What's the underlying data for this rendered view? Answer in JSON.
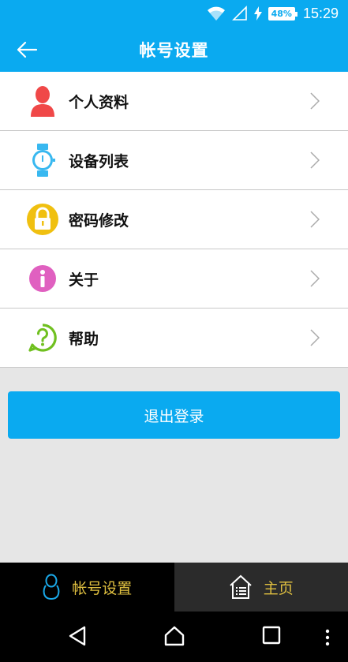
{
  "status_bar": {
    "battery": "48%",
    "time": "15:29"
  },
  "app_bar": {
    "title": "帐号设置"
  },
  "menu": {
    "items": [
      {
        "label": "个人资料",
        "icon": "person-icon",
        "color": "#f04848"
      },
      {
        "label": "设备列表",
        "icon": "watch-icon",
        "color": "#38b8f0"
      },
      {
        "label": "密码修改",
        "icon": "lock-icon",
        "color": "#f0c010"
      },
      {
        "label": "关于",
        "icon": "info-icon",
        "color": "#e060c0"
      },
      {
        "label": "帮助",
        "icon": "help-icon",
        "color": "#70c020"
      }
    ]
  },
  "logout": {
    "label": "退出登录"
  },
  "bottom_tabs": [
    {
      "label": "帐号设置",
      "icon": "account-icon"
    },
    {
      "label": "主页",
      "icon": "home-icon"
    }
  ],
  "colors": {
    "primary": "#0aaaf0",
    "tab_text": "#e0c040"
  }
}
